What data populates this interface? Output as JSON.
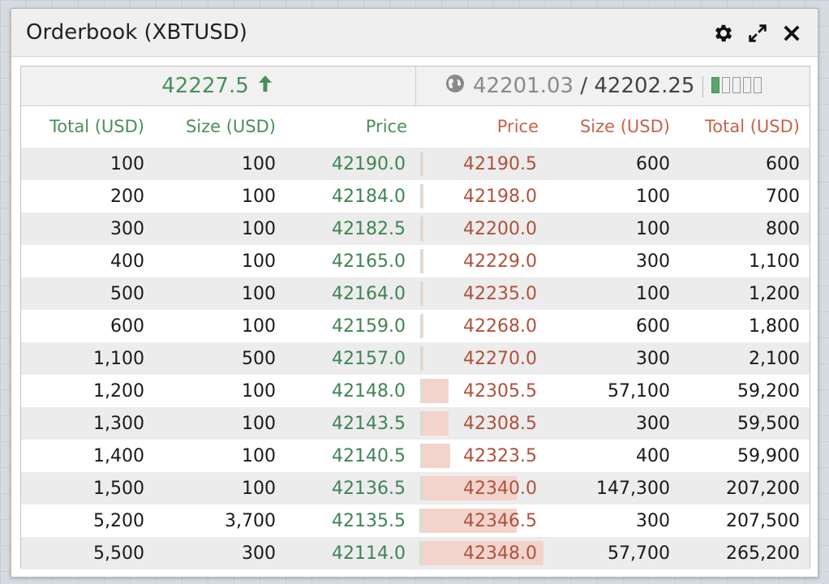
{
  "window": {
    "title": "Orderbook (XBTUSD)"
  },
  "toolbar": {
    "settings_icon": "gear-icon",
    "expand_icon": "expand-icon",
    "close_icon": "close-icon"
  },
  "summary": {
    "last_price": "42227.5",
    "direction": "up",
    "mark_price": "42201.03",
    "slash": " / ",
    "index_price": "42202.25",
    "connection_level": 1,
    "connection_total": 5
  },
  "colors": {
    "bid": "#4a8f59",
    "ask": "#c6634a",
    "bid_depth": "#c8e6cd",
    "ask_depth": "#f3d4cd"
  },
  "headers": {
    "bid_total": "Total (USD)",
    "bid_size": "Size (USD)",
    "bid_price": "Price",
    "ask_price": "Price",
    "ask_size": "Size (USD)",
    "ask_total": "Total (USD)"
  },
  "rows": [
    {
      "bid_total": "100",
      "bid_size": "100",
      "bid_price": "42190.0",
      "ask_price": "42190.5",
      "ask_size": "600",
      "ask_total": "600",
      "bid_depth": 0.01,
      "ask_depth": 0.01
    },
    {
      "bid_total": "200",
      "bid_size": "100",
      "bid_price": "42184.0",
      "ask_price": "42198.0",
      "ask_size": "100",
      "ask_total": "700",
      "bid_depth": 0.01,
      "ask_depth": 0.01
    },
    {
      "bid_total": "300",
      "bid_size": "100",
      "bid_price": "42182.5",
      "ask_price": "42200.0",
      "ask_size": "100",
      "ask_total": "800",
      "bid_depth": 0.01,
      "ask_depth": 0.01
    },
    {
      "bid_total": "400",
      "bid_size": "100",
      "bid_price": "42165.0",
      "ask_price": "42229.0",
      "ask_size": "300",
      "ask_total": "1,100",
      "bid_depth": 0.01,
      "ask_depth": 0.01
    },
    {
      "bid_total": "500",
      "bid_size": "100",
      "bid_price": "42164.0",
      "ask_price": "42235.0",
      "ask_size": "100",
      "ask_total": "1,200",
      "bid_depth": 0.01,
      "ask_depth": 0.01
    },
    {
      "bid_total": "600",
      "bid_size": "100",
      "bid_price": "42159.0",
      "ask_price": "42268.0",
      "ask_size": "600",
      "ask_total": "1,800",
      "bid_depth": 0.01,
      "ask_depth": 0.01
    },
    {
      "bid_total": "1,100",
      "bid_size": "500",
      "bid_price": "42157.0",
      "ask_price": "42270.0",
      "ask_size": "300",
      "ask_total": "2,100",
      "bid_depth": 0.01,
      "ask_depth": 0.01
    },
    {
      "bid_total": "1,200",
      "bid_size": "100",
      "bid_price": "42148.0",
      "ask_price": "42305.5",
      "ask_size": "57,100",
      "ask_total": "59,200",
      "bid_depth": 0.01,
      "ask_depth": 0.22
    },
    {
      "bid_total": "1,300",
      "bid_size": "100",
      "bid_price": "42143.5",
      "ask_price": "42308.5",
      "ask_size": "300",
      "ask_total": "59,500",
      "bid_depth": 0.01,
      "ask_depth": 0.22
    },
    {
      "bid_total": "1,400",
      "bid_size": "100",
      "bid_price": "42140.5",
      "ask_price": "42323.5",
      "ask_size": "400",
      "ask_total": "59,900",
      "bid_depth": 0.01,
      "ask_depth": 0.23
    },
    {
      "bid_total": "1,500",
      "bid_size": "100",
      "bid_price": "42136.5",
      "ask_price": "42340.0",
      "ask_size": "147,300",
      "ask_total": "207,200",
      "bid_depth": 0.01,
      "ask_depth": 0.78
    },
    {
      "bid_total": "5,200",
      "bid_size": "3,700",
      "bid_price": "42135.5",
      "ask_price": "42346.5",
      "ask_size": "300",
      "ask_total": "207,500",
      "bid_depth": 0.02,
      "ask_depth": 0.78
    },
    {
      "bid_total": "5,500",
      "bid_size": "300",
      "bid_price": "42114.0",
      "ask_price": "42348.0",
      "ask_size": "57,700",
      "ask_total": "265,200",
      "bid_depth": 0.02,
      "ask_depth": 1.0
    }
  ]
}
